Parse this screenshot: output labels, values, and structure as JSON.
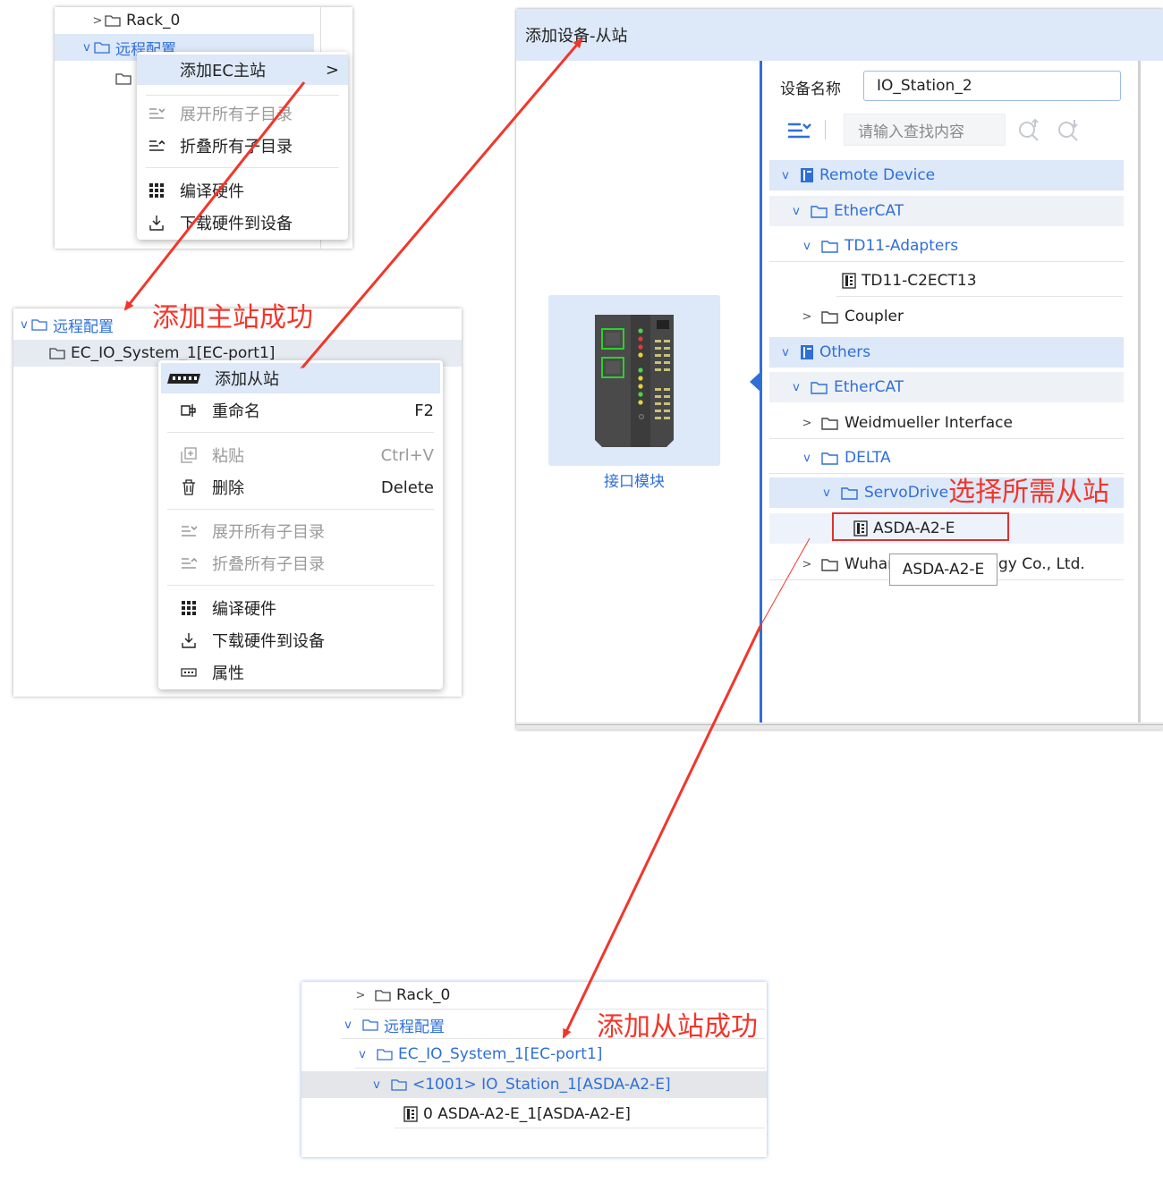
{
  "panel_a": {
    "rows": [
      "Rack_0",
      "远程配置"
    ],
    "menu": {
      "add_ec_master": "添加EC主站",
      "expand_all": "展开所有子目录",
      "collapse_all": "折叠所有子目录",
      "compile_hw": "编译硬件",
      "download_hw": "下载硬件到设备"
    }
  },
  "annotation_master": "添加主站成功",
  "panel_b": {
    "rows": [
      "远程配置",
      "EC_IO_System_1[EC-port1]"
    ],
    "menu": {
      "add_slave": "添加从站",
      "rename": "重命名",
      "rename_sc": "F2",
      "paste": "粘贴",
      "paste_sc": "Ctrl+V",
      "delete": "删除",
      "delete_sc": "Delete",
      "expand_all": "展开所有子目录",
      "collapse_all": "折叠所有子目录",
      "compile_hw": "编译硬件",
      "download_hw": "下载硬件到设备",
      "properties": "属性"
    }
  },
  "dialog": {
    "title": "添加设备-从站",
    "device_name_label": "设备名称",
    "device_name_value": "IO_Station_2",
    "search_placeholder": "请输入查找内容",
    "module_caption": "接口模块",
    "tree": [
      "Remote Device",
      "EtherCAT",
      "TD11-Adapters",
      "TD11-C2ECT13",
      "Coupler",
      "Others",
      "EtherCAT",
      "Weidmueller Interface",
      "DELTA",
      "ServoDrive",
      "ASDA-A2-E",
      "Wuhan",
      "gy Co., Ltd."
    ],
    "tooltip": "ASDA-A2-E"
  },
  "annotation_select": "选择所需从站",
  "panel_c": {
    "rows": [
      "Rack_0",
      "远程配置",
      "EC_IO_System_1[EC-port1]",
      "<1001> IO_Station_1[ASDA-A2-E]",
      "0 ASDA-A2-E_1[ASDA-A2-E]"
    ]
  },
  "annotation_slave": "添加从站成功",
  "colors": {
    "accent": "#2f6fd8",
    "annotation": "#f2362b",
    "selection": "#dde8f8"
  }
}
